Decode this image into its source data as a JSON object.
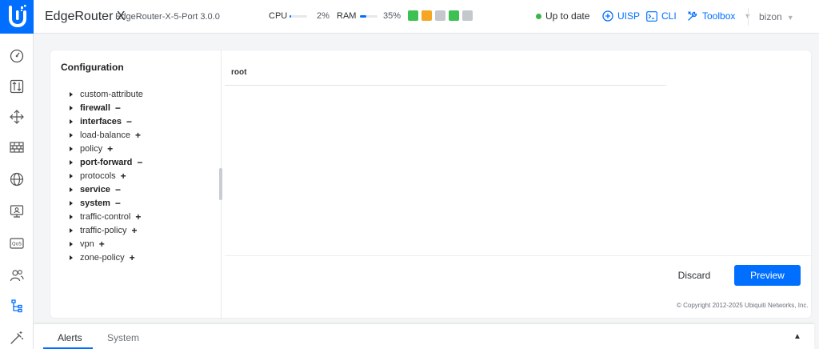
{
  "header": {
    "title": "EdgeRouter X",
    "subtitle": "EdgeRouter-X-5-Port 3.0.0",
    "cpu_label": "CPU",
    "cpu_value": "2%",
    "cpu_fraction": 0.02,
    "ram_label": "RAM",
    "ram_value": "35%",
    "ram_fraction": 0.35,
    "ports": [
      {
        "status": "up",
        "color": "#3cc152"
      },
      {
        "status": "warn",
        "color": "#f5a623"
      },
      {
        "status": "down",
        "color": "#c4c7cb"
      },
      {
        "status": "up",
        "color": "#3cc152"
      },
      {
        "status": "down",
        "color": "#c4c7cb"
      }
    ],
    "status_text": "Up to date",
    "uisp_label": "UISP",
    "cli_label": "CLI",
    "toolbox_label": "Toolbox",
    "user": "bizon",
    "accent_color": "#006fff"
  },
  "sidebar": {
    "items": [
      {
        "icon": "dashboard-icon"
      },
      {
        "icon": "routing-icon"
      },
      {
        "icon": "firewall-nat-icon"
      },
      {
        "icon": "firewall-icon"
      },
      {
        "icon": "services-icon"
      },
      {
        "icon": "users-monitor-icon"
      },
      {
        "icon": "qos-icon"
      },
      {
        "icon": "users-icon"
      },
      {
        "icon": "config-tree-icon"
      },
      {
        "icon": "wizards-icon"
      }
    ]
  },
  "config": {
    "title": "Configuration",
    "tree": [
      {
        "label": "custom-attribute",
        "bold": false,
        "toggle": ""
      },
      {
        "label": "firewall",
        "bold": true,
        "toggle": "−"
      },
      {
        "label": "interfaces",
        "bold": true,
        "toggle": "−"
      },
      {
        "label": "load-balance",
        "bold": false,
        "toggle": "+"
      },
      {
        "label": "policy",
        "bold": false,
        "toggle": "+"
      },
      {
        "label": "port-forward",
        "bold": true,
        "toggle": "−"
      },
      {
        "label": "protocols",
        "bold": false,
        "toggle": "+"
      },
      {
        "label": "service",
        "bold": true,
        "toggle": "−"
      },
      {
        "label": "system",
        "bold": true,
        "toggle": "−"
      },
      {
        "label": "traffic-control",
        "bold": false,
        "toggle": "+"
      },
      {
        "label": "traffic-policy",
        "bold": false,
        "toggle": "+"
      },
      {
        "label": "vpn",
        "bold": false,
        "toggle": "+"
      },
      {
        "label": "zone-policy",
        "bold": false,
        "toggle": "+"
      }
    ],
    "root_label": "root",
    "discard_label": "Discard",
    "preview_label": "Preview",
    "copyright": "© Copyright 2012-2025 Ubiquiti Networks, Inc."
  },
  "bottom": {
    "tabs": [
      {
        "label": "Alerts",
        "active": true
      },
      {
        "label": "System",
        "active": false
      }
    ],
    "collapse_icon": "chevron-up-icon"
  }
}
